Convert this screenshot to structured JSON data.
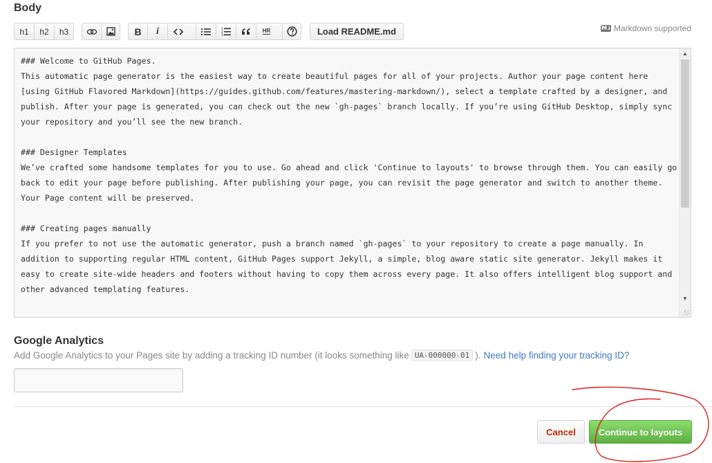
{
  "body_section": {
    "heading": "Body",
    "toolbar": {
      "h1": "h1",
      "h2": "h2",
      "h3": "h3",
      "bold": "B",
      "italic": "i",
      "hr": "HR",
      "load_readme": "Load README.md"
    },
    "markdown_badge": "M↓",
    "markdown_note": "Markdown supported",
    "editor_text": "### Welcome to GitHub Pages.\nThis automatic page generator is the easiest way to create beautiful pages for all of your projects. Author your page content here [using GitHub Flavored Markdown](https://guides.github.com/features/mastering-markdown/), select a template crafted by a designer, and publish. After your page is generated, you can check out the new `gh-pages` branch locally. If you’re using GitHub Desktop, simply sync your repository and you’ll see the new branch.\n\n### Designer Templates\nWe’ve crafted some handsome templates for you to use. Go ahead and click 'Continue to layouts' to browse through them. You can easily go back to edit your page before publishing. After publishing your page, you can revisit the page generator and switch to another theme. Your Page content will be preserved.\n\n### Creating pages manually\nIf you prefer to not use the automatic generator, push a branch named `gh-pages` to your repository to create a page manually. In addition to supporting regular HTML content, GitHub Pages support Jekyll, a simple, blog aware static site generator. Jekyll makes it easy to create site-wide headers and footers without having to copy them across every page. It also offers intelligent blog support and other advanced templating features."
  },
  "analytics": {
    "heading": "Google Analytics",
    "description": "Add Google Analytics to your Pages site by adding a tracking ID number (it looks something like",
    "example_id": "UA-000000-01",
    "after_code": ").",
    "help_link": "Need help finding your tracking ID?",
    "input_value": ""
  },
  "actions": {
    "cancel": "Cancel",
    "continue": "Continue to layouts"
  },
  "colors": {
    "continue_green": "#60b044",
    "cancel_red": "#bd2c00",
    "link_blue": "#4078c0",
    "annotation_red": "#e0201b"
  }
}
